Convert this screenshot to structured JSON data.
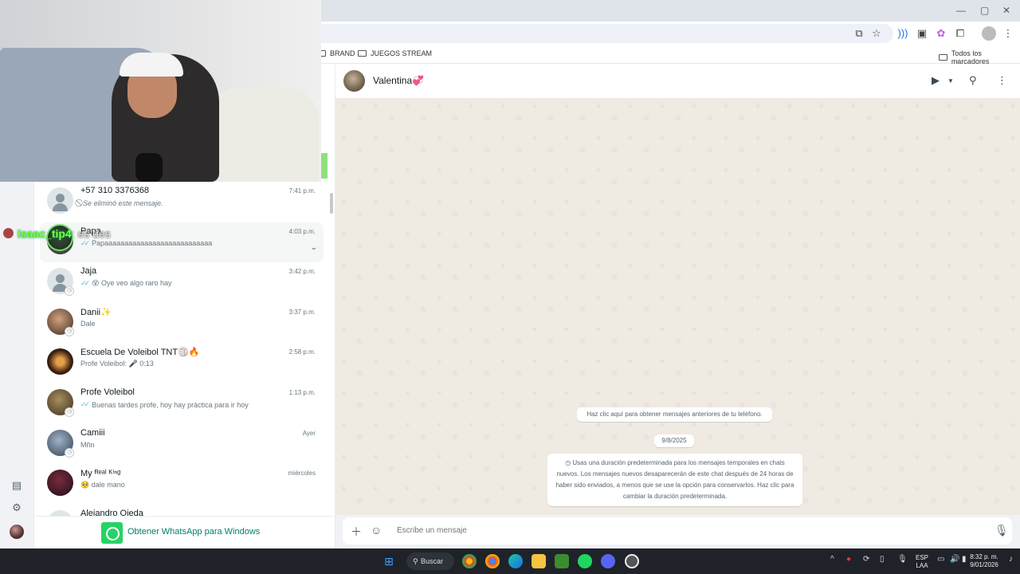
{
  "browser": {
    "bookmarks": [
      {
        "label": "BRAND"
      },
      {
        "label": "JUEGOS STREAM"
      }
    ],
    "all_bookmarks_label": "Todos los marcadores"
  },
  "overlay": {
    "username": "Isaac_tip4",
    "suffix": ": es des"
  },
  "chats": [
    {
      "name": "+57 310 3376368",
      "time": "7:41 p.m.",
      "preview": "Se eliminó este mensaje.",
      "preview_icon": "⃠",
      "avatar": "default",
      "ticks": false
    },
    {
      "name": "Papa",
      "time": "4:03 p.m.",
      "preview": "Papaaaaaaaaaaaaaaaaaaaaaaaaaaa",
      "avatar": "photo",
      "ticks": true,
      "hover": true
    },
    {
      "name": "Jaja",
      "time": "3:42 p.m.",
      "preview": "😵 Oye veo algo raro hay",
      "avatar": "default",
      "ticks": true
    },
    {
      "name": "Danii✨",
      "time": "3:37 p.m.",
      "preview": "Dale",
      "avatar": "photo",
      "ticks": false
    },
    {
      "name": "Escuela De Voleibol TNT🏐🔥",
      "time": "2:58 p.m.",
      "preview": "Profe Voleibol: 🎤 0:13",
      "avatar": "photo",
      "ticks": false
    },
    {
      "name": "Profe Voleibol",
      "time": "1:13 p.m.",
      "preview": "Buenas tardes profe, hoy hay práctica para ir hoy",
      "avatar": "photo",
      "ticks": true
    },
    {
      "name": "Camiii",
      "time": "Ayer",
      "preview": "Mñn",
      "avatar": "photo",
      "ticks": false
    },
    {
      "name": "My ᴿᵉᵃˡ ᴷⁱⁿᵍ",
      "time": "miércoles",
      "preview": "🥺 dale mano",
      "avatar": "photo",
      "ticks": false
    },
    {
      "name": "Alejandro Ojeda",
      "time": "",
      "preview": "",
      "avatar": "default",
      "ticks": false
    }
  ],
  "get_whatsapp": "Obtener WhatsApp para Windows",
  "chat": {
    "contact_name": "Valentina💞",
    "load_older": "Haz clic aquí para obtener mensajes anteriores de tu teléfono.",
    "date_chip": "9/8/2025",
    "system_message": "Usas una duración predeterminada para los mensajes temporales en chats nuevos. Los mensajes nuevos desaparecerán de este chat después de 24 horas de haber sido enviados, a menos que se use la opción para conservarlos. Haz clic para cambiar la duración predeterminada.",
    "composer_placeholder": "Escribe un mensaje"
  },
  "taskbar": {
    "search_label": "Buscar",
    "language_line1": "ESP",
    "language_line2": "LAA",
    "time": "8:32 p. m.",
    "date": "9/01/2026"
  },
  "colors": {
    "accent": "#25d366",
    "wa_green_text": "#008069",
    "tick_blue": "#53bdeb",
    "chat_bg": "#efeae2"
  }
}
